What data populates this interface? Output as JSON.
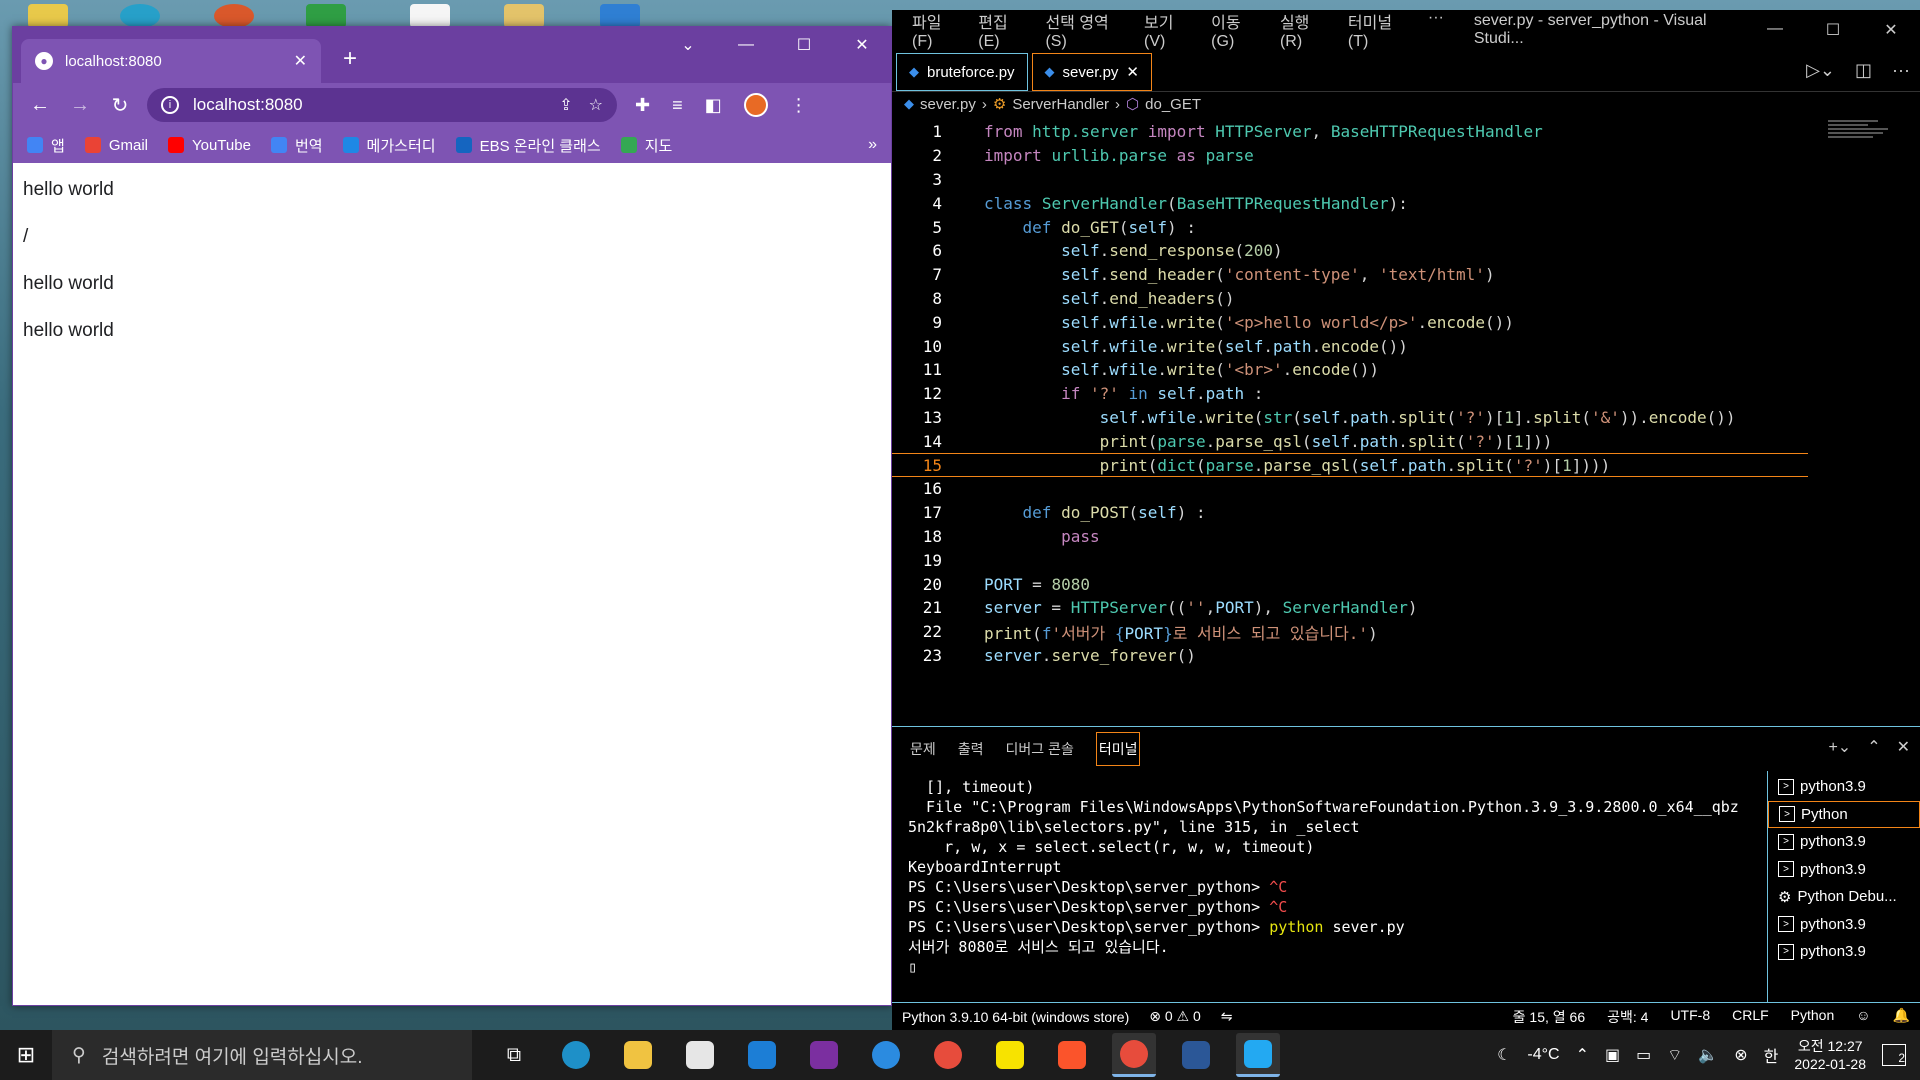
{
  "browser": {
    "tab_title": "localhost:8080",
    "url": "localhost:8080",
    "bookmarks": [
      {
        "label": "앱",
        "color": "#4285f4"
      },
      {
        "label": "Gmail",
        "color": "#ea4335"
      },
      {
        "label": "YouTube",
        "color": "#ff0000"
      },
      {
        "label": "번역",
        "color": "#4285f4"
      },
      {
        "label": "메가스터디",
        "color": "#1e88e5"
      },
      {
        "label": "EBS 온라인 클래스",
        "color": "#1565c0"
      },
      {
        "label": "지도",
        "color": "#34a853"
      }
    ],
    "page_lines": [
      "hello world",
      "/",
      "hello world",
      "hello world"
    ]
  },
  "vscode": {
    "menu": [
      "파일(F)",
      "편집(E)",
      "선택 영역(S)",
      "보기(V)",
      "이동(G)",
      "실행(R)",
      "터미널(T)",
      "···"
    ],
    "window_title": "sever.py - server_python - Visual Studi...",
    "tabs": [
      {
        "label": "bruteforce.py",
        "active": false
      },
      {
        "label": "sever.py",
        "active": true
      }
    ],
    "breadcrumb": [
      "sever.py",
      "ServerHandler",
      "do_GET"
    ],
    "current_line": 15,
    "panel_tabs": [
      "문제",
      "출력",
      "디버그 콘솔",
      "터미널"
    ],
    "terminal_lines": [
      "  [], timeout)",
      "  File \"C:\\Program Files\\WindowsApps\\PythonSoftwareFoundation.Python.3.9_3.9.2800.0_x64__qbz",
      "5n2kfra8p0\\lib\\selectors.py\", line 315, in _select",
      "    r, w, x = select.select(r, w, w, timeout)",
      "KeyboardInterrupt",
      "PS C:\\Users\\user\\Desktop\\server_python> ",
      "PS C:\\Users\\user\\Desktop\\server_python> ",
      "PS C:\\Users\\user\\Desktop\\server_python> ",
      "서버가 8080로 서비스 되고 있습니다."
    ],
    "ctrl_c": "^C",
    "run_cmd": "python",
    "run_arg": " sever.py",
    "terminal_instances": [
      "python3.9",
      "Python",
      "python3.9",
      "python3.9",
      "Python Debu...",
      "python3.9",
      "python3.9"
    ],
    "status": {
      "interpreter": "Python 3.9.10 64-bit (windows store)",
      "errors": "0",
      "warnings": "0",
      "position": "줄 15, 열 66",
      "spaces": "공백: 4",
      "encoding": "UTF-8",
      "eol": "CRLF",
      "language": "Python"
    }
  },
  "taskbar": {
    "search_placeholder": "검색하려면 여기에 입력하십시오.",
    "temperature": "-4°C",
    "ime": "한",
    "time": "오전 12:27",
    "date": "2022-01-28",
    "notifications": "2"
  }
}
